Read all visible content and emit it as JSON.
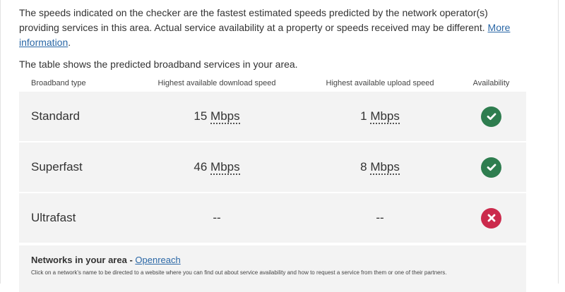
{
  "intro": {
    "text": "The speeds indicated on the checker are the fastest estimated speeds predicted by the network operator(s) providing services in this area. Actual service availability at a property or speeds received may be different.",
    "link": "More information",
    "end": "."
  },
  "caption": "The table shows the predicted broadband services in your area.",
  "table": {
    "headers": [
      "Broadband type",
      "Highest available download speed",
      "Highest available upload speed",
      "Availability"
    ],
    "rows": [
      {
        "type": "Standard",
        "down_value": "15",
        "down_unit": "Mbps",
        "up_value": "1",
        "up_unit": "Mbps",
        "available": true
      },
      {
        "type": "Superfast",
        "down_value": "46",
        "down_unit": "Mbps",
        "up_value": "8",
        "up_unit": "Mbps",
        "available": true
      },
      {
        "type": "Ultrafast",
        "down_none": "--",
        "up_none": "--",
        "available": false
      }
    ]
  },
  "networks": {
    "title": "Networks in your area - ",
    "link": "Openreach",
    "note": "Click on a network's name to be directed to a website where you can find out about service availability and how to request a service from them or one of their partners."
  },
  "colors": {
    "available": "#2e7d4f",
    "unavailable": "#cb2a4c",
    "link": "#2a67a6",
    "row_background": "#f3f3f3"
  },
  "icons": {
    "available": "check-circle-icon",
    "unavailable": "cross-circle-icon"
  }
}
